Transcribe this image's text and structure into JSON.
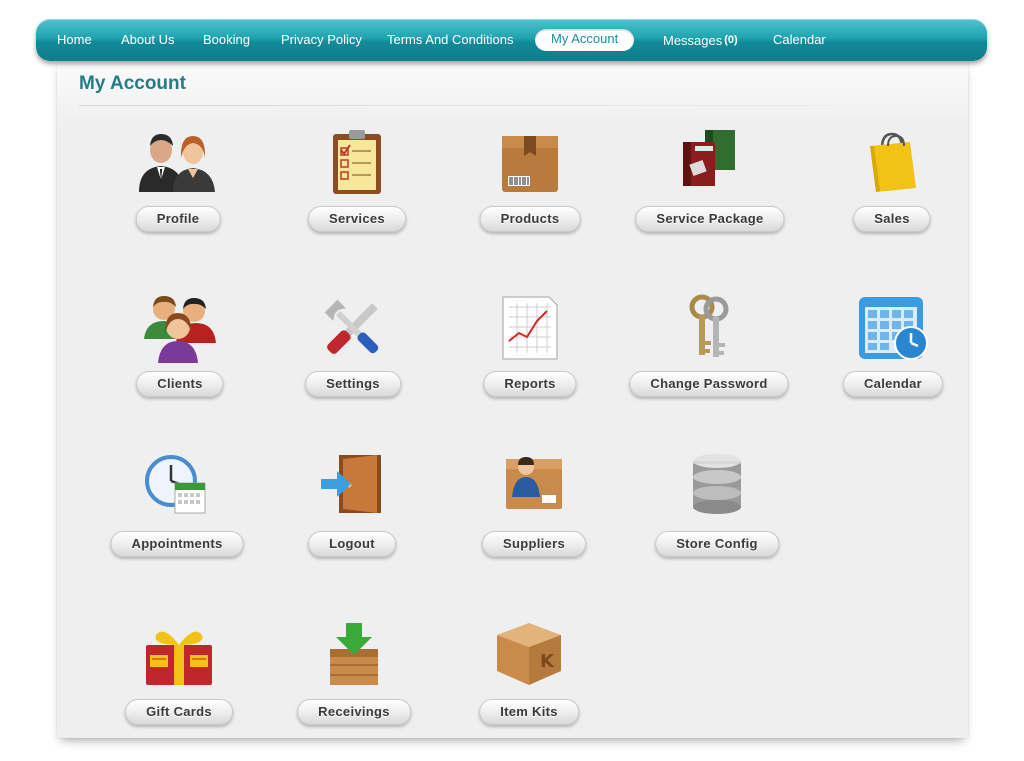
{
  "nav": {
    "items": [
      {
        "label": "Home"
      },
      {
        "label": "About Us"
      },
      {
        "label": "Booking"
      },
      {
        "label": "Privacy Policy"
      },
      {
        "label": "Terms And Conditions"
      },
      {
        "label": "My Account"
      },
      {
        "label": "Messages",
        "count": "(0)"
      },
      {
        "label": "Calendar"
      }
    ],
    "active_item": "My Account"
  },
  "page": {
    "title": "My Account"
  },
  "tiles": [
    {
      "label": "Profile",
      "icon": "profile-icon"
    },
    {
      "label": "Services",
      "icon": "clipboard-icon"
    },
    {
      "label": "Products",
      "icon": "box-icon"
    },
    {
      "label": "Service  Package",
      "icon": "package-icon"
    },
    {
      "label": "Sales",
      "icon": "shopping-bag-icon"
    },
    {
      "label": "Clients",
      "icon": "clients-icon"
    },
    {
      "label": "Settings",
      "icon": "tools-icon"
    },
    {
      "label": "Reports",
      "icon": "report-chart-icon"
    },
    {
      "label": "Change Password",
      "icon": "keys-icon"
    },
    {
      "label": "Calendar",
      "icon": "calendar-clock-icon"
    },
    {
      "label": "Appointments",
      "icon": "appointment-clock-icon"
    },
    {
      "label": "Logout",
      "icon": "door-exit-icon"
    },
    {
      "label": "Suppliers",
      "icon": "supplier-icon"
    },
    {
      "label": "Store Config",
      "icon": "database-icon"
    },
    {
      "label": "Gift Cards",
      "icon": "gift-card-icon"
    },
    {
      "label": "Receivings",
      "icon": "receiving-box-icon"
    },
    {
      "label": "Item Kits",
      "icon": "item-kit-box-icon"
    }
  ],
  "colors": {
    "nav_gradient_top": "#4fc3cc",
    "nav_gradient_bottom": "#0f7d8a",
    "active_text": "#17909c",
    "title_text": "#247d86",
    "panel_bg": "#efefef"
  }
}
